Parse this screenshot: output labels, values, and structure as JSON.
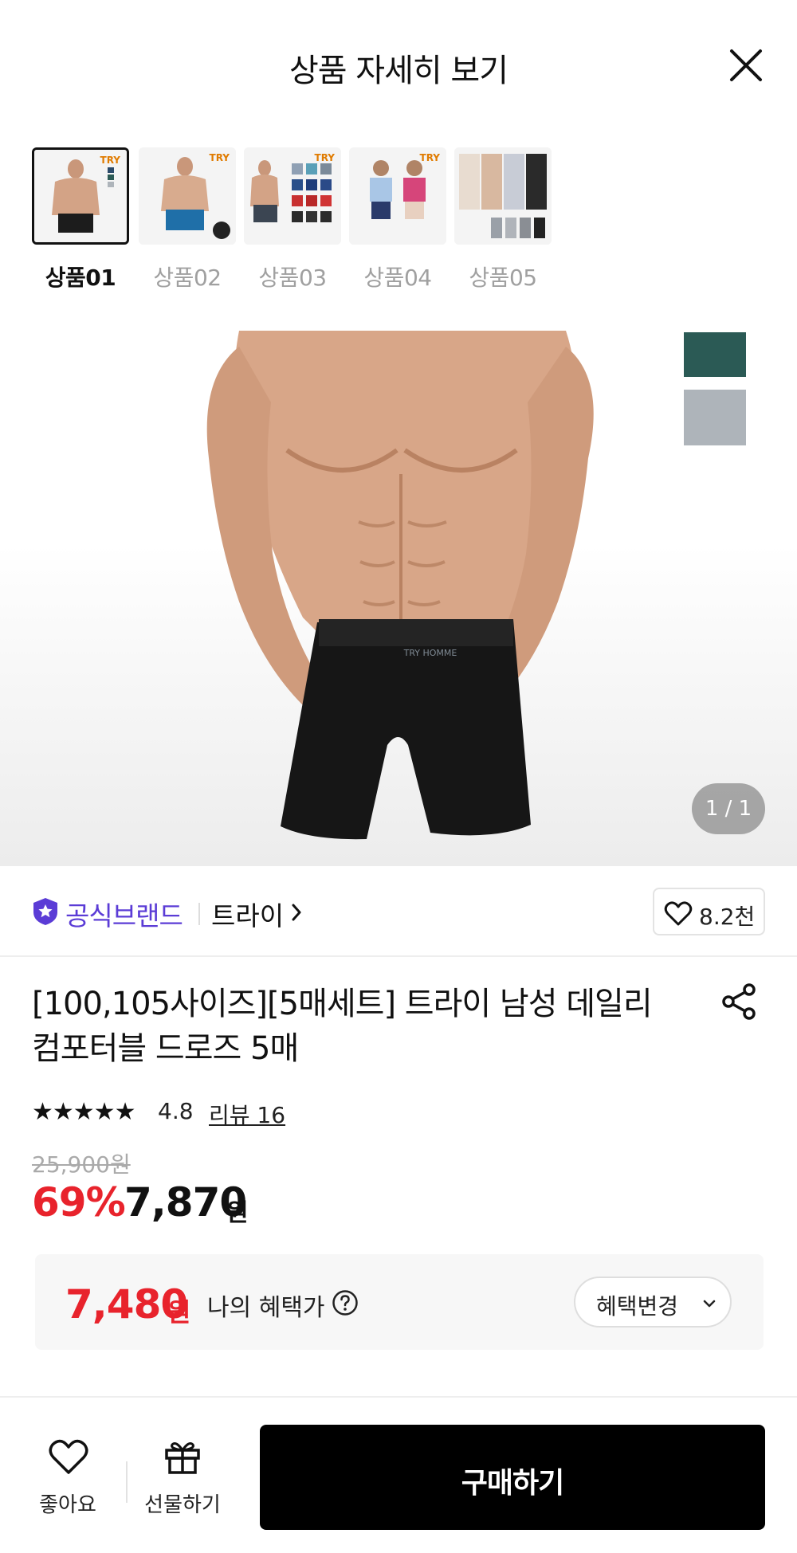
{
  "header": {
    "title": "상품 자세히 보기"
  },
  "thumbnails": [
    {
      "label": "상품01",
      "badge": "TRY",
      "active": true
    },
    {
      "label": "상품02",
      "badge": "TRY",
      "active": false
    },
    {
      "label": "상품03",
      "badge": "TRY",
      "active": false
    },
    {
      "label": "상품04",
      "badge": "TRY",
      "active": false
    },
    {
      "label": "상품05",
      "badge": "",
      "active": false
    }
  ],
  "main_image": {
    "counter": "1 / 1",
    "waistband_text": "TRY HOMME",
    "swatch_colors": [
      "#2b5a55",
      "#aeb4ba"
    ]
  },
  "brand": {
    "official_label": "공식브랜드",
    "name": "트라이",
    "like_count": "8.2천"
  },
  "product": {
    "title_line1": "[100,105사이즈][5매세트] 트라이 남성 데일리",
    "title_line2": "컴포터블 드로즈 5매",
    "stars": "★★★★★",
    "rating": "4.8",
    "review_label": "리뷰 16",
    "original_price": "25,900원",
    "discount": "69%",
    "sale_price": "7,870",
    "sale_unit": "원"
  },
  "benefit": {
    "price": "7,480",
    "unit": "원",
    "label": "나의 혜택가",
    "change_button": "혜택변경"
  },
  "bottom_bar": {
    "like_label": "좋아요",
    "gift_label": "선물하기",
    "buy_label": "구매하기"
  },
  "colors": {
    "accent_red": "#e8232c",
    "official_purple": "#5b3cd6",
    "buy_button": "#000000"
  }
}
